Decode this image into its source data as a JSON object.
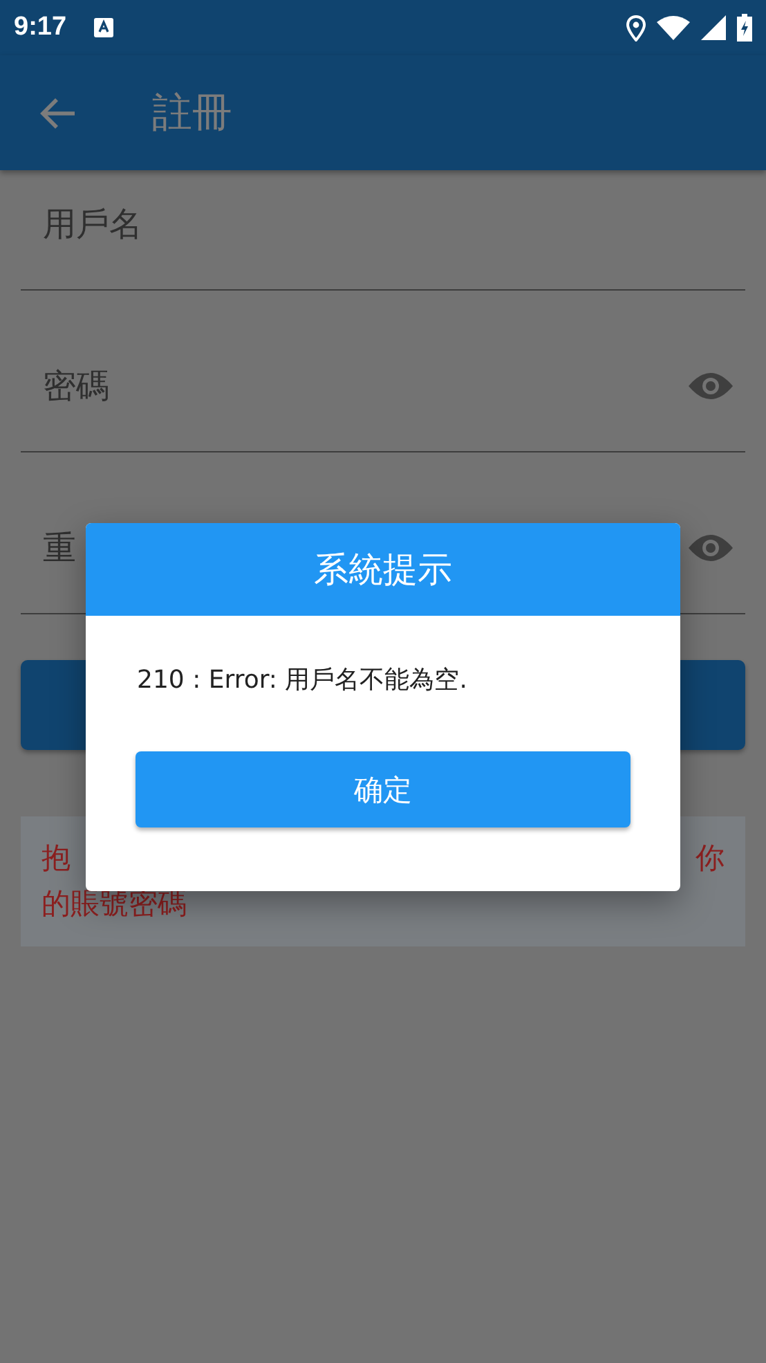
{
  "status_bar": {
    "time": "9:17"
  },
  "app_bar": {
    "title": "註冊"
  },
  "fields": [
    {
      "label": "用戶名",
      "kind": "text"
    },
    {
      "label": "密碼",
      "kind": "password"
    },
    {
      "label": "重",
      "kind": "password"
    }
  ],
  "notice": {
    "line_1_start": "抱",
    "line_1_end": "你",
    "line_2": "的賬號密碼"
  },
  "dialog": {
    "title": "系統提示",
    "message": "210 : Error: 用戶名不能為空.",
    "button": "确定"
  }
}
